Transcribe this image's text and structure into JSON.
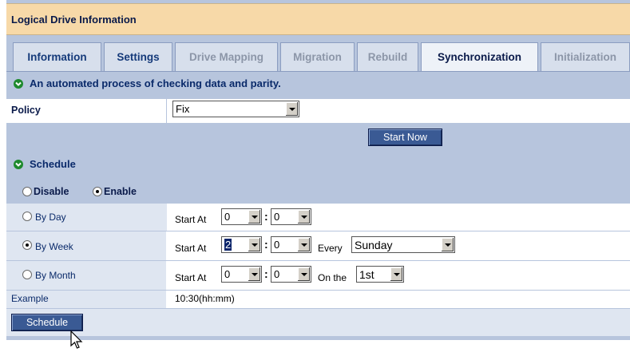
{
  "window": {
    "title": "Logical Drive Information"
  },
  "tabs": [
    {
      "label": "Information",
      "state": "normal"
    },
    {
      "label": "Settings",
      "state": "normal"
    },
    {
      "label": "Drive Mapping",
      "state": "disabled"
    },
    {
      "label": "Migration",
      "state": "disabled"
    },
    {
      "label": "Rebuild",
      "state": "disabled"
    },
    {
      "label": "Synchronization",
      "state": "active"
    },
    {
      "label": "Initialization",
      "state": "disabled"
    }
  ],
  "description": "An automated process of checking data and parity.",
  "policy": {
    "label": "Policy",
    "selected": "Fix"
  },
  "start_now_button": "Start Now",
  "schedule": {
    "heading": "Schedule",
    "disable_label": "Disable",
    "enable_label": "Enable",
    "enabled": true,
    "start_at_label": "Start At",
    "by_day": {
      "label": "By Day",
      "hour": "0",
      "minute": "0"
    },
    "by_week": {
      "label": "By Week",
      "hour": "2",
      "minute": "0",
      "every_label": "Every",
      "day": "Sunday"
    },
    "by_month": {
      "label": "By Month",
      "hour": "0",
      "minute": "0",
      "on_the_label": "On the",
      "day": "1st"
    },
    "selected_option": "By Week",
    "example_label": "Example",
    "example_value": "10:30(hh:mm)",
    "button": "Schedule"
  },
  "colors": {
    "accent": "#1e8a2e",
    "panel": "#b7c5dd",
    "title_bar": "#f7d9a8",
    "button": "#3a5a94"
  },
  "icons": {
    "section": "check-circle-icon",
    "cursor": "mouse-pointer-icon"
  }
}
